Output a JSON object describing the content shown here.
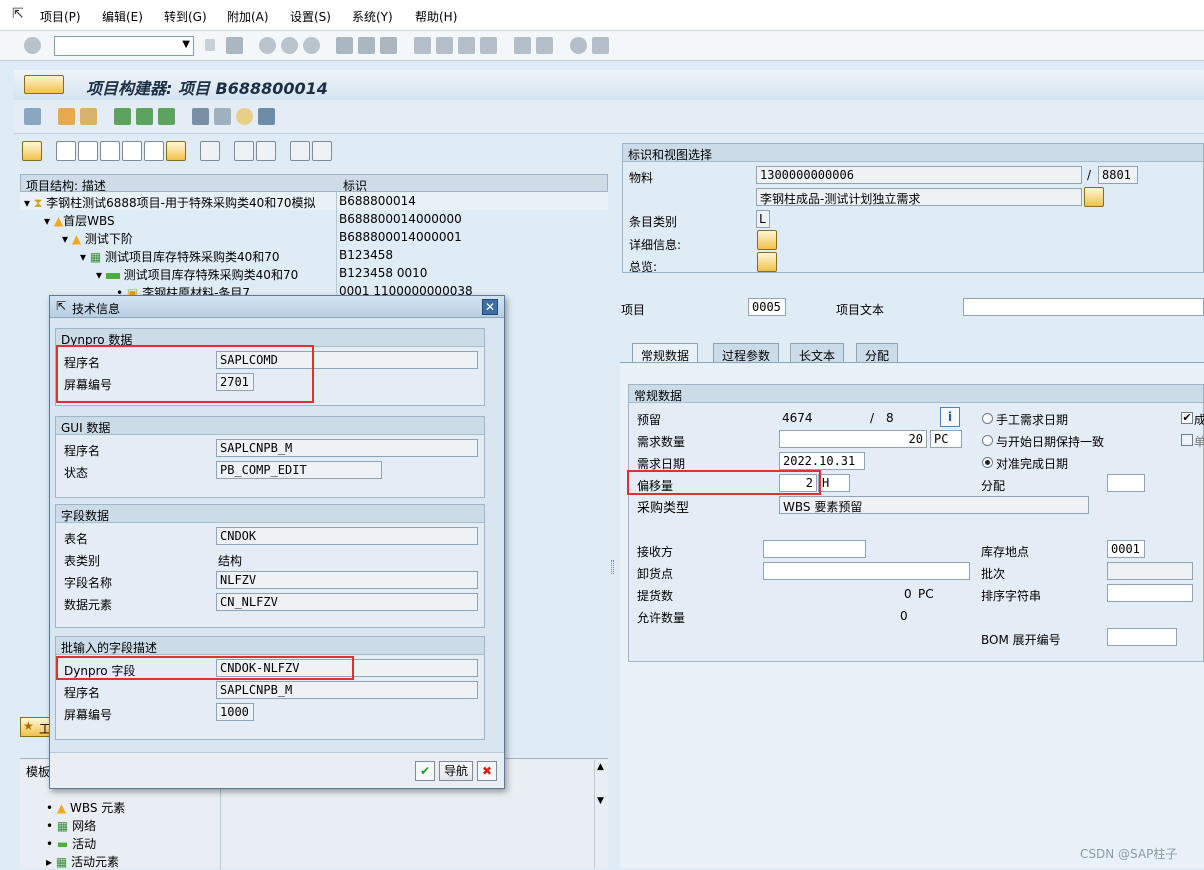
{
  "menu": {
    "items": [
      "项目(P)",
      "编辑(E)",
      "转到(G)",
      "附加(A)",
      "设置(S)",
      "系统(Y)",
      "帮助(H)"
    ]
  },
  "title": {
    "text": "项目构建器: 项目 B688800014"
  },
  "tree": {
    "col_desc": "项目结构: 描述",
    "col_id": "标识",
    "rows": [
      {
        "desc": "李钢柱测试6888项目-用于特殊采购类40和70模拟",
        "id": "B688800014"
      },
      {
        "desc": "首层WBS",
        "id": "B688800014000000"
      },
      {
        "desc": "测试下阶",
        "id": "B688800014000001"
      },
      {
        "desc": "测试项目库存特殊采购类40和70",
        "id": "B123458"
      },
      {
        "desc": "测试项目库存特殊采购类40和70",
        "id": "B123458 0010"
      },
      {
        "desc": "李钢柱原材料-条目7",
        "id": "0001 1100000000038"
      }
    ]
  },
  "templates": {
    "header": "模板",
    "items": [
      "WBS 元素",
      "网络",
      "活动",
      "活动元素"
    ]
  },
  "worklist_label": "工",
  "right": {
    "ident_header": "标识和视图选择",
    "material_label": "物料",
    "material_value": "1300000000006",
    "plant_value": "8801",
    "material_desc": "李钢柱成品-测试计划独立需求",
    "item_category_label": "条目类别",
    "item_category_value": "L",
    "detail_label": "详细信息:",
    "overview_label": "总览:",
    "item_label": "项目",
    "item_value": "0005",
    "item_text_label": "项目文本",
    "tabs": [
      "常规数据",
      "过程参数",
      "长文本",
      "分配"
    ],
    "general_header": "常规数据",
    "reservation_label": "预留",
    "reservation_value": "4674",
    "reservation_item": "8",
    "req_qty_label": "需求数量",
    "req_qty_value": "20",
    "req_qty_unit": "PC",
    "req_date_label": "需求日期",
    "req_date_value": "2022.10.31",
    "offset_label": "偏移量",
    "offset_value": "2",
    "offset_unit": "H",
    "proc_type_label": "采购类型",
    "proc_type_value": "WBS 要素预留",
    "radio1": "手工需求日期",
    "radio2": "与开始日期保持一致",
    "radio3": "对准完成日期",
    "assign_label": "分配",
    "check1": "成",
    "check2": "单",
    "recipient_label": "接收方",
    "unload_label": "卸货点",
    "withdrawn_label": "提货数",
    "withdrawn_value": "0",
    "withdrawn_unit": "PC",
    "allowed_label": "允许数量",
    "allowed_value": "0",
    "storage_label": "库存地点",
    "storage_value": "0001",
    "batch_label": "批次",
    "sort_label": "排序字符串",
    "bom_label": "BOM 展开编号"
  },
  "dialog": {
    "title": "技术信息",
    "g1_header": "Dynpro 数据",
    "g1_prog_label": "程序名",
    "g1_prog_value": "SAPLCOMD",
    "g1_screen_label": "屏幕编号",
    "g1_screen_value": "2701",
    "g2_header": "GUI 数据",
    "g2_prog_label": "程序名",
    "g2_prog_value": "SAPLCNPB_M",
    "g2_status_label": "状态",
    "g2_status_value": "PB_COMP_EDIT",
    "g3_header": "字段数据",
    "g3_table_label": "表名",
    "g3_table_value": "CNDOK",
    "g3_tabtype_label": "表类别",
    "g3_tabtype_value": "结构",
    "g3_field_label": "字段名称",
    "g3_field_value": "NLFZV",
    "g3_elem_label": "数据元素",
    "g3_elem_value": "CN_NLFZV",
    "g4_header": "批输入的字段描述",
    "g4_dynfield_label": "Dynpro 字段",
    "g4_dynfield_value": "CNDOK-NLFZV",
    "g4_prog_label": "程序名",
    "g4_prog_value": "SAPLCNPB_M",
    "g4_screen_label": "屏幕编号",
    "g4_screen_value": "1000",
    "nav_button": "导航"
  },
  "watermark": "CSDN @SAP柱子",
  "colors": {
    "highlight": "#e03030",
    "accent": "#f0c14a",
    "panel": "#dfebf5"
  }
}
